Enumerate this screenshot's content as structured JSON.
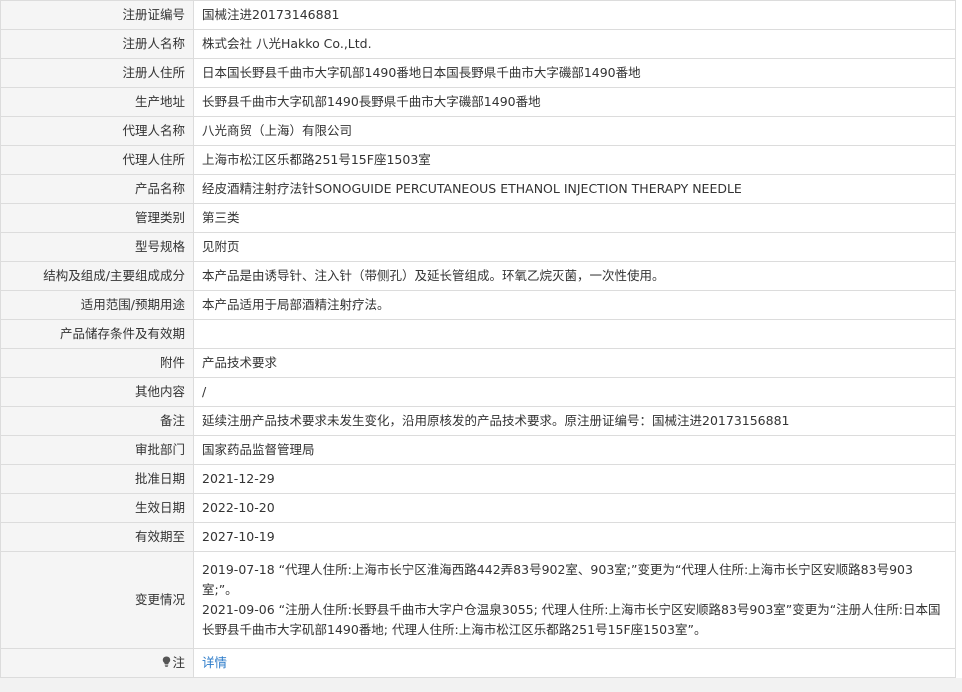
{
  "rows": [
    {
      "label": "注册证编号",
      "value": "国械注进20173146881"
    },
    {
      "label": "注册人名称",
      "value": "株式会社 八光Hakko Co.,Ltd."
    },
    {
      "label": "注册人住所",
      "value": "日本国长野县千曲市大字矶部1490番地日本国長野県千曲市大字磯部1490番地"
    },
    {
      "label": "生产地址",
      "value": "长野县千曲市大字矶部1490長野県千曲市大字磯部1490番地"
    },
    {
      "label": "代理人名称",
      "value": "八光商贸（上海）有限公司"
    },
    {
      "label": "代理人住所",
      "value": "上海市松江区乐都路251号15F座1503室"
    },
    {
      "label": "产品名称",
      "value": "经皮酒精注射疗法针SONOGUIDE PERCUTANEOUS ETHANOL INJECTION THERAPY NEEDLE"
    },
    {
      "label": "管理类别",
      "value": "第三类"
    },
    {
      "label": "型号规格",
      "value": "见附页"
    },
    {
      "label": "结构及组成/主要组成成分",
      "value": "本产品是由诱导针、注入针（带侧孔）及延长管组成。环氧乙烷灭菌，一次性使用。"
    },
    {
      "label": "适用范围/预期用途",
      "value": "本产品适用于局部酒精注射疗法。"
    },
    {
      "label": "产品储存条件及有效期",
      "value": ""
    },
    {
      "label": "附件",
      "value": "产品技术要求"
    },
    {
      "label": "其他内容",
      "value": "/"
    },
    {
      "label": "备注",
      "value": "延续注册产品技术要求未发生变化，沿用原核发的产品技术要求。原注册证编号：国械注进20173156881"
    },
    {
      "label": "审批部门",
      "value": "国家药品监督管理局"
    },
    {
      "label": "批准日期",
      "value": "2021-12-29"
    },
    {
      "label": "生效日期",
      "value": "2022-10-20"
    },
    {
      "label": "有效期至",
      "value": "2027-10-19"
    }
  ],
  "changes": {
    "label": "变更情况",
    "entries": [
      "2019-07-18 “代理人住所:上海市长宁区淮海西路442弄83号902室、903室;”变更为“代理人住所:上海市长宁区安顺路83号903室;”。",
      "2021-09-06 “注册人住所:长野县千曲市大字户仓温泉3055; 代理人住所:上海市长宁区安顺路83号903室”变更为“注册人住所:日本国长野县千曲市大字矶部1490番地; 代理人住所:上海市松江区乐都路251号15F座1503室”。"
    ]
  },
  "note": {
    "icon": "lightbulb-icon",
    "label": "注",
    "link_text": "详情",
    "link_color": "#2a7ac9"
  }
}
